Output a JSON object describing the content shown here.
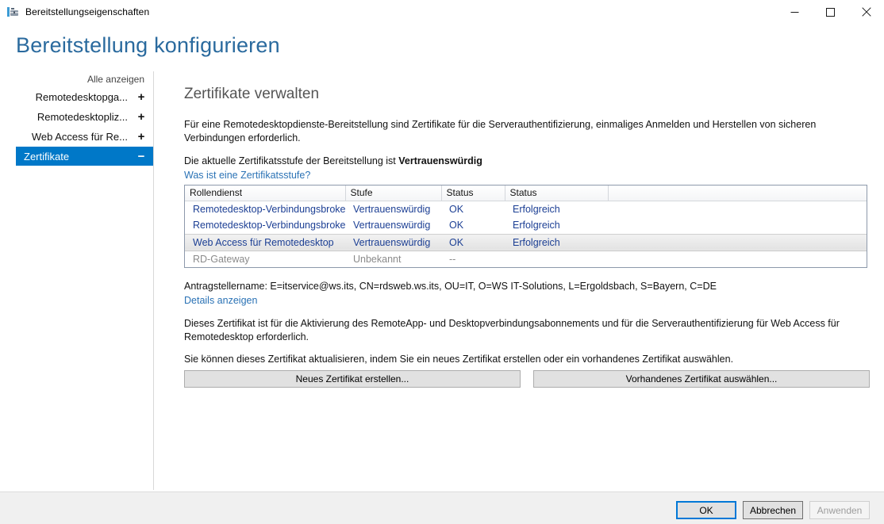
{
  "window": {
    "title": "Bereitstellungseigenschaften",
    "icon": "deployment-properties-icon",
    "minimize_label": "–",
    "maximize_label": "□",
    "close_label": "✕"
  },
  "page": {
    "heading": "Bereitstellung konfigurieren"
  },
  "sidebar": {
    "show_all": "Alle anzeigen",
    "items": [
      {
        "label": "Remotedesktopga...",
        "sign": "+",
        "selected": false
      },
      {
        "label": "Remotedesktopliz...",
        "sign": "+",
        "selected": false
      },
      {
        "label": "Web Access für Re...",
        "sign": "+",
        "selected": false
      },
      {
        "label": "Zertifikate",
        "sign": "−",
        "selected": true
      }
    ]
  },
  "content": {
    "title": "Zertifikate verwalten",
    "intro": "Für eine Remotedesktopdienste-Bereitstellung sind Zertifikate für die Serverauthentifizierung, einmaliges Anmelden und Herstellen von sicheren Verbindungen erforderlich.",
    "level_prefix": "Die aktuelle Zertifikatsstufe der Bereitstellung ist ",
    "level_value": "Vertrauenswürdig",
    "level_link": "Was ist eine Zertifikatsstufe?",
    "subject_name": "Antragstellername: E=itservice@ws.its, CN=rdsweb.ws.its, OU=IT, O=WS IT-Solutions, L=Ergoldsbach, S=Bayern, C=DE",
    "details_link": "Details anzeigen",
    "usage_text": "Dieses Zertifikat ist für die Aktivierung des RemoteApp- und Desktopverbindungsabonnements und für die Serverauthentifizierung für Web Access für Remotedesktop erforderlich.",
    "update_text": "Sie können dieses Zertifikat aktualisieren, indem Sie ein neues Zertifikat erstellen oder ein vorhandenes Zertifikat auswählen.",
    "btn_new": "Neues Zertifikat erstellen...",
    "btn_existing": "Vorhandenes Zertifikat auswählen..."
  },
  "table": {
    "headers": [
      "Rollendienst",
      "Stufe",
      "Status",
      "Status",
      ""
    ],
    "rows": [
      {
        "cells": [
          "Remotedesktop-Verbindungsbroker",
          "Vertrauenswürdig",
          "OK",
          "Erfolgreich",
          ""
        ],
        "selected": false,
        "disabled": false
      },
      {
        "cells": [
          "Remotedesktop-Verbindungsbroker",
          "Vertrauenswürdig",
          "OK",
          "Erfolgreich",
          ""
        ],
        "selected": false,
        "disabled": false
      },
      {
        "cells": [
          "Web Access für Remotedesktop",
          "Vertrauenswürdig",
          "OK",
          "Erfolgreich",
          ""
        ],
        "selected": true,
        "disabled": false
      },
      {
        "cells": [
          "RD-Gateway",
          "Unbekannt",
          "--",
          "",
          ""
        ],
        "selected": false,
        "disabled": true
      }
    ]
  },
  "footer": {
    "ok": "OK",
    "cancel": "Abbrechen",
    "apply": "Anwenden"
  },
  "colors": {
    "accent": "#0078c8",
    "heading": "#2a6a9e",
    "link": "#2a72b5",
    "grid_text": "#1c3f94",
    "disabled_text": "#8a8a8a"
  }
}
